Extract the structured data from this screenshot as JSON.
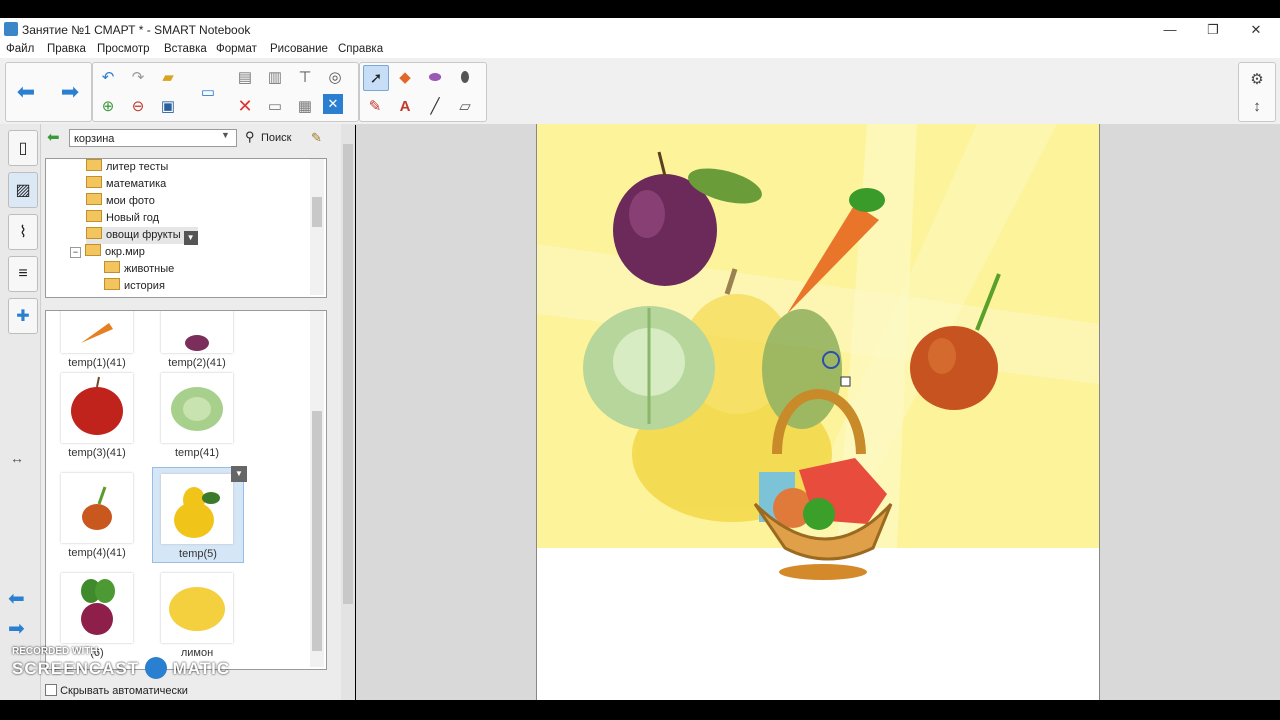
{
  "window": {
    "title": "Занятие №1 СМАРТ * - SMART Notebook",
    "controls": {
      "minimize": "—",
      "restore": "❐",
      "close": "✕"
    }
  },
  "menu": [
    "Файл",
    "Правка",
    "Просмотр",
    "Вставка",
    "Формат",
    "Рисование",
    "Справка"
  ],
  "gallery": {
    "search_value": "корзина",
    "search_label": "Поиск",
    "tree": [
      {
        "label": "литер тесты",
        "level": 1
      },
      {
        "label": "математика",
        "level": 1
      },
      {
        "label": "мои фото",
        "level": 1
      },
      {
        "label": "Новый год",
        "level": 1
      },
      {
        "label": "овощи фрукты",
        "level": 1
      },
      {
        "label": "окр.мир",
        "level": 1
      },
      {
        "label": "животные",
        "level": 2
      },
      {
        "label": "история",
        "level": 2
      }
    ],
    "thumbs": [
      {
        "caption": "temp(1)(41)"
      },
      {
        "caption": "temp(2)(41)"
      },
      {
        "caption": "temp(3)(41)"
      },
      {
        "caption": "temp(41)"
      },
      {
        "caption": "temp(4)(41)"
      },
      {
        "caption": "temp(5)"
      },
      {
        "caption": "(6)"
      },
      {
        "caption": "лимон"
      }
    ],
    "autohide_label": "Скрывать автоматически"
  },
  "watermark": {
    "line1": "RECORDED WITH",
    "line2": "SCREENCAST",
    "line3": "MATIC"
  },
  "colors": {
    "accent": "#3a86c8",
    "page_bg": "#fcf39a",
    "selection": "#d5e6f7"
  }
}
